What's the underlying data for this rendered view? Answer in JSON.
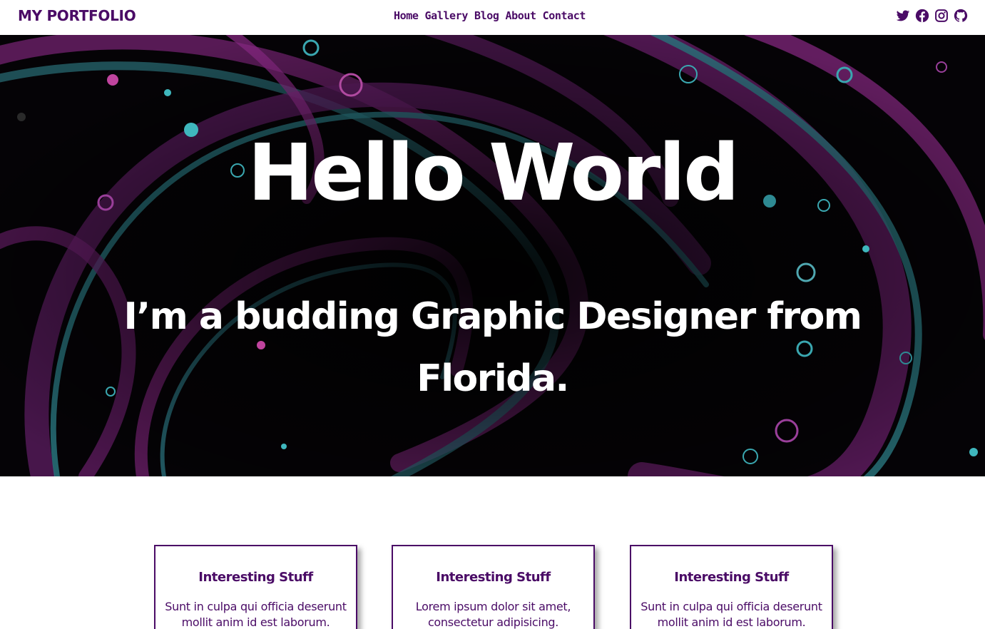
{
  "nav": {
    "brand": "MY PORTFOLIO",
    "links": [
      "Home",
      "Gallery",
      "Blog",
      "About",
      "Contact"
    ],
    "social_icons": [
      "twitter-icon",
      "facebook-icon",
      "instagram-icon",
      "github-icon"
    ]
  },
  "hero": {
    "title": "Hello World",
    "subtitle": "I’m a budding Graphic Designer from Florida."
  },
  "cards": [
    {
      "title": "Interesting Stuff",
      "text": "Sunt in culpa qui officia deserunt mollit anim id est laborum."
    },
    {
      "title": "Interesting Stuff",
      "text": "Lorem ipsum dolor sit amet, consectetur adipisicing."
    },
    {
      "title": "Interesting Stuff",
      "text": "Sunt in culpa qui officia deserunt mollit anim id est laborum."
    }
  ],
  "colors": {
    "accent": "#4a0b66",
    "hero_bg": "#050306",
    "swirl_purple": "#8a2a86",
    "swirl_teal": "#2a7f86"
  }
}
